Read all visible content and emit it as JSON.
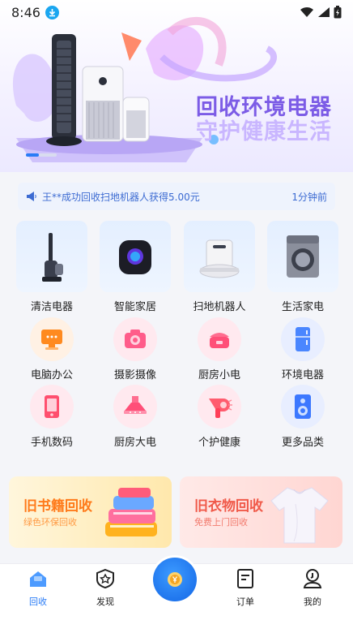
{
  "status_bar": {
    "time": "8:46"
  },
  "hero": {
    "title": "回收环境电器",
    "subtitle": "守护健康生活"
  },
  "notice": {
    "message": "王**成功回收扫地机器人获得5.00元",
    "time": "1分钟前"
  },
  "categories": [
    {
      "label": "清洁电器",
      "icon": "vacuum-icon"
    },
    {
      "label": "智能家居",
      "icon": "smart-speaker-icon"
    },
    {
      "label": "扫地机器人",
      "icon": "robot-vacuum-icon"
    },
    {
      "label": "生活家电",
      "icon": "washing-machine-icon"
    }
  ],
  "icon_items": [
    {
      "label": "电脑办公",
      "icon": "computer-icon"
    },
    {
      "label": "摄影摄像",
      "icon": "camera-icon"
    },
    {
      "label": "厨房小电",
      "icon": "rice-cooker-icon"
    },
    {
      "label": "环境电器",
      "icon": "fridge-icon"
    },
    {
      "label": "手机数码",
      "icon": "phone-icon"
    },
    {
      "label": "厨房大电",
      "icon": "range-hood-icon"
    },
    {
      "label": "个护健康",
      "icon": "hair-dryer-icon"
    },
    {
      "label": "更多品类",
      "icon": "speaker-icon"
    }
  ],
  "banners": [
    {
      "title": "旧书籍回收",
      "subtitle": "绿色环保回收"
    },
    {
      "title": "旧衣物回收",
      "subtitle": "免费上门回收"
    }
  ],
  "tabs": [
    {
      "label": "回收",
      "icon": "recycle-home-icon"
    },
    {
      "label": "发现",
      "icon": "discover-icon"
    },
    {
      "label": "订单",
      "icon": "order-icon"
    },
    {
      "label": "我的",
      "icon": "profile-icon"
    }
  ],
  "center_button": {
    "icon": "yen-coin-icon"
  },
  "colors": {
    "accent": "#2a7cf6",
    "hero_title": "#7c5ce6",
    "hero_subtitle": "#c9b6ff",
    "notice_text": "#3c6bd2"
  }
}
